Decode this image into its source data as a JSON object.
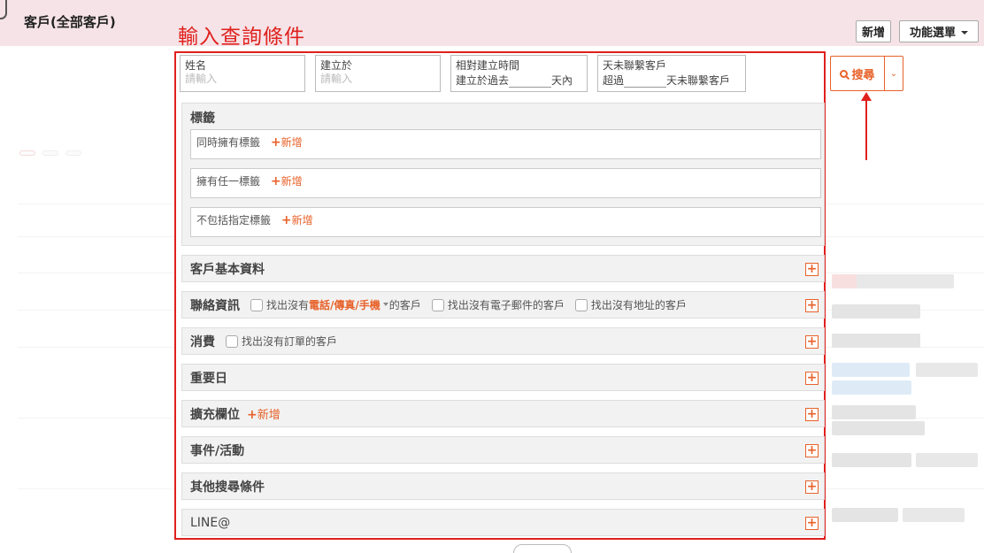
{
  "header": {
    "title": "客戶(全部客戶)",
    "annotation": "輸入查詢條件",
    "new_button": "新增",
    "function_menu": "功能選單"
  },
  "fields": {
    "name": {
      "label": "姓名",
      "placeholder": "請輸入"
    },
    "created_at": {
      "label": "建立於",
      "placeholder": "請輸入"
    },
    "relative_created": {
      "label": "相對建立時間",
      "prefix": "建立於過去",
      "suffix": "天內"
    },
    "no_contact_days": {
      "label": "天未聯繫客戶",
      "prefix": "超過",
      "suffix": "天未聯繫客戶"
    }
  },
  "tags": {
    "title": "標籤",
    "all_tags": "同時擁有標籤",
    "any_tag": "擁有任一標籤",
    "exclude_tags": "不包括指定標籤",
    "add_label": "新增",
    "add_symbol": "+"
  },
  "sections": {
    "basic": "客戶基本資料",
    "contact": "聯絡資訊",
    "contact_chk1_prefix": "找出沒有",
    "contact_chk1_highlight": "電話/傳真/手機",
    "contact_chk1_suffix": "的客戶",
    "contact_chk2": "找出沒有電子郵件的客戶",
    "contact_chk3": "找出沒有地址的客戶",
    "consumption": "消費",
    "consumption_chk": "找出沒有訂單的客戶",
    "important_date": "重要日",
    "extended_fields": "擴充欄位",
    "extended_add": "新增",
    "events": "事件/活動",
    "other": "其他搜尋條件",
    "line": "LINE@",
    "expand_symbol": "+"
  },
  "search": {
    "label": "搜尋"
  },
  "colors": {
    "accent": "#e8622a",
    "annotation_red": "#e0201c",
    "header_bg": "#f5e3e7"
  }
}
